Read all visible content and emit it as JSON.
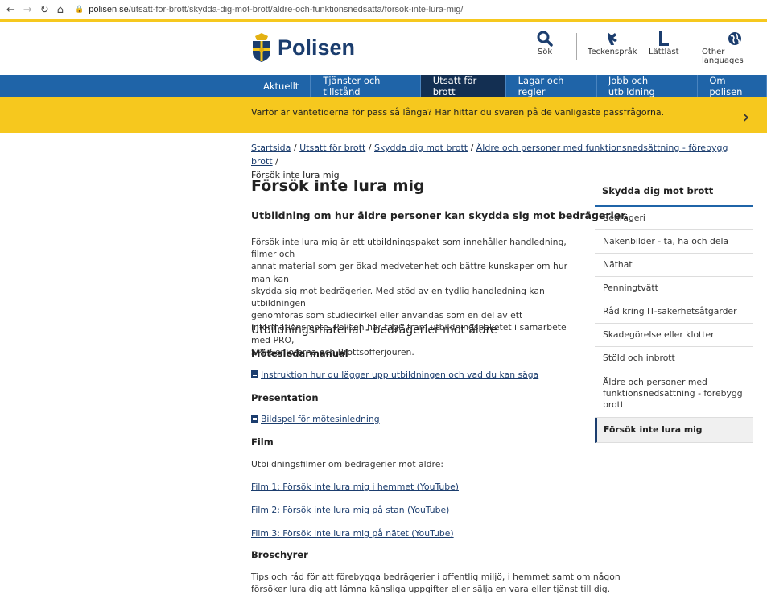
{
  "browser": {
    "url_host": "polisen.se",
    "url_path": "/utsatt-for-brott/skydda-dig-mot-brott/aldre-och-funktionsnedsatta/forsok-inte-lura-mig/"
  },
  "header": {
    "logo_text": "Polisen",
    "icons": [
      {
        "label": "Sök",
        "icon": "search-icon"
      },
      {
        "label": "Teckenspråk",
        "icon": "sign-language-icon"
      },
      {
        "label": "Lättläst",
        "icon": "easy-read-icon"
      },
      {
        "label": "Other languages",
        "icon": "globe-icon"
      }
    ]
  },
  "nav": {
    "items": [
      "Aktuellt",
      "Tjänster och tillstånd",
      "Utsatt för brott",
      "Lagar och regler",
      "Jobb och utbildning",
      "Om polisen"
    ],
    "active_index": 2
  },
  "banner": {
    "text": "Varför är väntetiderna för pass så långa? Här hittar du svaren på de vanligaste passfrågorna.",
    "arrow": "›"
  },
  "breadcrumb": {
    "links": [
      "Startsida",
      "Utsatt för brott",
      "Skydda dig mot brott",
      "Äldre och personer med funktionsnedsättning - förebygg brott"
    ],
    "current": "Försök inte lura mig",
    "separator": " / "
  },
  "main": {
    "title": "Försök inte lura mig",
    "lead": "Utbildning om hur äldre personer kan skydda sig mot bedrägerier.",
    "body_lines": [
      "Försök inte lura mig är ett utbildningspaket som innehåller handledning, filmer och",
      "annat material som ger ökad medvetenhet och bättre kunskaper om hur man kan",
      "skydda sig mot bedrägerier. Med stöd av en tydlig handledning kan utbildningen",
      "genomföras som studiecirkel eller användas som en del av ett",
      "informationsmöte. Polisen har tagit fram utbildningspaketet i samarbete med PRO,",
      "SPF Seniorerna och Brottsofferjouren."
    ],
    "section_title": "Utbildningsmaterial - bedrägerier mot äldre",
    "manual_heading": "Mötesledarmanual",
    "manual_link": "Instruktion hur du lägger upp utbildningen och vad du kan säga",
    "presentation_heading": "Presentation",
    "presentation_link": "Bildspel för mötesinledning",
    "film_heading": "Film",
    "film_intro": "Utbildningsfilmer om bedrägerier mot äldre:",
    "film_links": [
      "Film 1: Försök inte lura mig i hemmet (YouTube)",
      "Film 2: Försök inte lura mig på stan (YouTube)",
      "Film 3: Försök inte lura mig på nätet (YouTube)"
    ],
    "brochures_heading": "Broschyrer",
    "brochures_lines": [
      "Tips och råd för att förebygga bedrägerier i offentlig miljö, i hemmet samt om någon",
      "försöker lura dig att lämna känsliga uppgifter eller sälja en vara eller tjänst till dig."
    ]
  },
  "sidebar": {
    "title": "Skydda dig mot brott",
    "items": [
      "Bedrägeri",
      "Nakenbilder - ta, ha och dela",
      "Näthat",
      "Penningtvätt",
      "Råd kring IT-säkerhetsåtgärder",
      "Skadegörelse eller klotter",
      "Stöld och inbrott",
      "Äldre och personer med funktionsnedsättning - förebygg brott",
      "Försök inte lura mig"
    ],
    "current_index": 8
  },
  "colors": {
    "brand_blue": "#1f64a8",
    "active_nav": "#132f52",
    "banner_yellow": "#f6c81e",
    "link": "#1b3d6e"
  }
}
